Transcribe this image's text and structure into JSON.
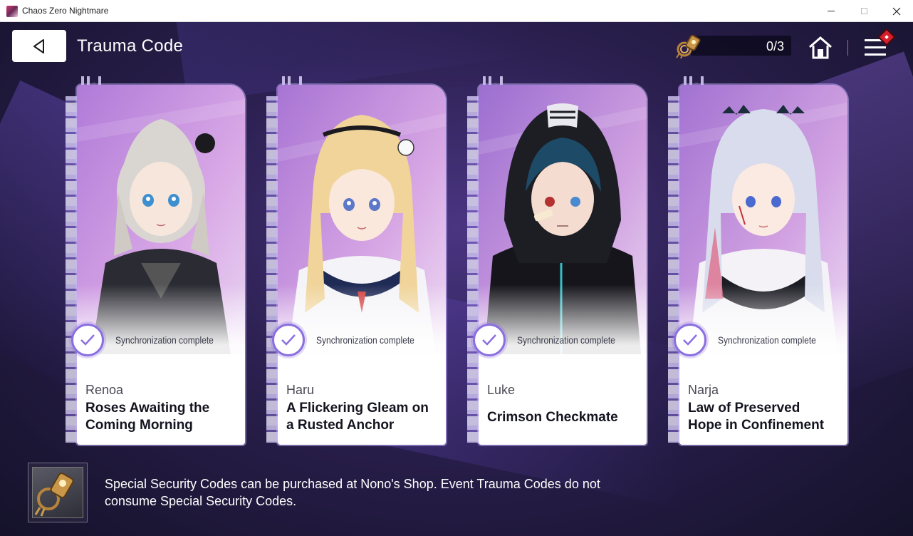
{
  "window": {
    "title": "Chaos Zero Nightmare",
    "minimize": "—",
    "maximize": "☐",
    "close": "✕"
  },
  "header": {
    "title": "Trauma Code",
    "currency_count": "0/3",
    "back_icon": "back-triangle-icon",
    "home_icon": "home-icon",
    "menu_icon": "hamburger-menu-icon"
  },
  "cards": [
    {
      "character": "Renoa",
      "title": "Roses Awaiting the Coming Morning",
      "status": "Synchronization complete",
      "hair": "#d9d6d2",
      "accent": "#2b2b33"
    },
    {
      "character": "Haru",
      "title": "A Flickering Gleam on a Rusted Anchor",
      "status": "Synchronization complete",
      "hair": "#f0d49a",
      "accent": "#1f2a55"
    },
    {
      "character": "Luke",
      "title": "Crimson Checkmate",
      "status": "Synchronization complete",
      "hair": "#1d4a66",
      "accent": "#15151b"
    },
    {
      "character": "Narja",
      "title": "Law of Preserved Hope in Confinement",
      "status": "Synchronization complete",
      "hair": "#d8dcec",
      "accent": "#1c1c24"
    }
  ],
  "footer": {
    "notice_line1": "Special Security Codes can be purchased at Nono's Shop. Event Trauma Codes do not",
    "notice_line2": "consume Special Security Codes."
  },
  "colors": {
    "accent_purple": "#8b6fe0",
    "badge_red": "#d8202c"
  }
}
